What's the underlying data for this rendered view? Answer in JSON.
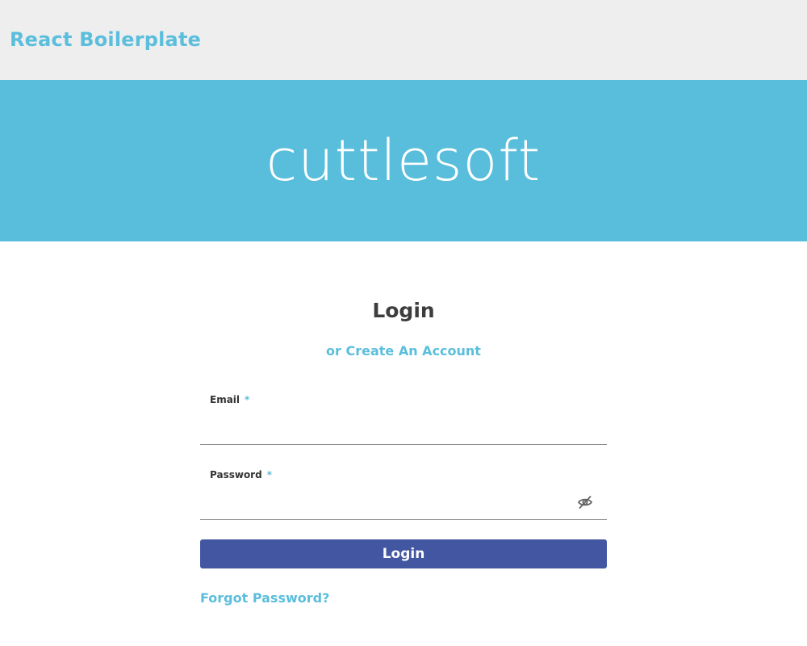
{
  "header": {
    "brand": "React Boilerplate"
  },
  "banner": {
    "logo_text": "cuttlesoft"
  },
  "login_form": {
    "title": "Login",
    "create_account_link": "or Create An Account",
    "email": {
      "label": "Email",
      "required_marker": "*",
      "value": ""
    },
    "password": {
      "label": "Password",
      "required_marker": "*",
      "value": "",
      "toggle_icon": "eye-slash-icon"
    },
    "submit_label": "Login",
    "forgot_link": "Forgot Password?"
  },
  "colors": {
    "accent": "#5bbedc",
    "banner_bg": "#59bedc",
    "topbar_bg": "#eeeeee",
    "button_bg": "#4356a1",
    "title_text": "#3d3d3d"
  }
}
